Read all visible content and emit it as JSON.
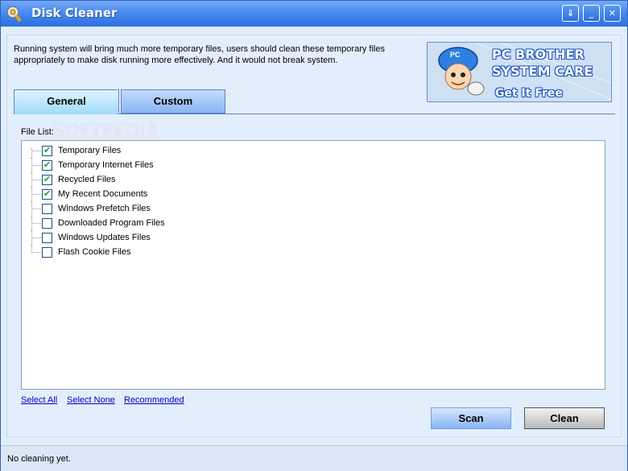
{
  "window": {
    "title": "Disk Cleaner",
    "controls": {
      "options_glyph": "⇓",
      "minimize_glyph": "_",
      "close_glyph": "✕"
    }
  },
  "intro_text": "Running system will bring much more temporary files, users should clean these temporary files appropriately to make disk running more effectively. And it would not break system.",
  "banner": {
    "line1": "PC BROTHER",
    "line2": "SYSTEM CARE",
    "line3": "Get It Free",
    "mascot_badge": "PC"
  },
  "tabs": [
    {
      "label": "General",
      "active": true
    },
    {
      "label": "Custom",
      "active": false
    }
  ],
  "watermark": "SOFTPEDIA",
  "file_list": {
    "label": "File List:",
    "items": [
      {
        "label": "Temporary Files",
        "checked": true
      },
      {
        "label": "Temporary Internet Files",
        "checked": true
      },
      {
        "label": "Recycled Files",
        "checked": true
      },
      {
        "label": "My Recent Documents",
        "checked": true
      },
      {
        "label": "Windows Prefetch Files",
        "checked": false
      },
      {
        "label": "Downloaded Program Files",
        "checked": false
      },
      {
        "label": "Windows Updates Files",
        "checked": false
      },
      {
        "label": "Flash Cookie Files",
        "checked": false
      }
    ]
  },
  "links": {
    "select_all": "Select All",
    "select_none": "Select None",
    "recommended": "Recommended"
  },
  "buttons": {
    "scan": "Scan",
    "clean": "Clean"
  },
  "status": "No cleaning yet.",
  "colors": {
    "titlebar": "#2b6fe0",
    "client_bg": "#e3eefc",
    "check_green": "#21a121",
    "link_blue": "#0000cc"
  },
  "icons": {
    "app": "disk-cleaner-icon",
    "check": "check-icon"
  }
}
